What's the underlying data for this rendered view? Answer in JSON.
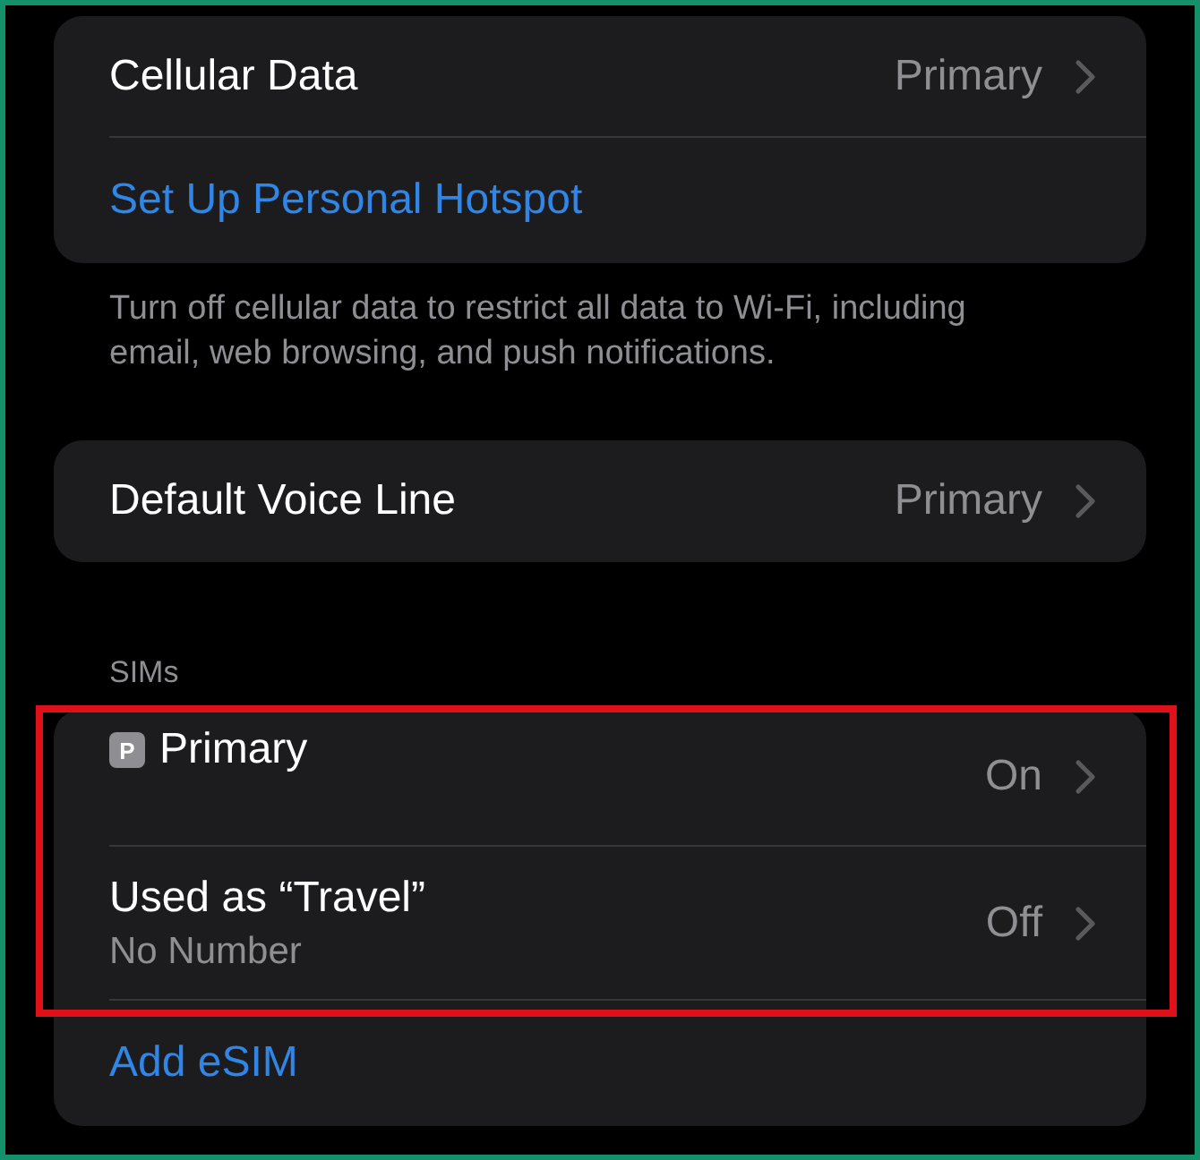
{
  "groups": [
    {
      "rows": [
        {
          "kind": "nav",
          "title": "Cellular Data",
          "value": "Primary"
        },
        {
          "kind": "action",
          "title": "Set Up Personal Hotspot"
        }
      ],
      "footer": "Turn off cellular data to restrict all data to Wi-Fi, including email, web browsing, and push notifications."
    },
    {
      "rows": [
        {
          "kind": "nav",
          "title": "Default Voice Line",
          "value": "Primary"
        }
      ]
    },
    {
      "header": "SIMs",
      "rows": [
        {
          "kind": "sim",
          "badge": "P",
          "title": "Primary",
          "value": "On",
          "highlighted": true
        },
        {
          "kind": "sim",
          "title": "Used as “Travel”",
          "subtitle": "No Number",
          "value": "Off",
          "highlighted": true
        },
        {
          "kind": "action",
          "title": "Add eSIM"
        }
      ]
    }
  ]
}
